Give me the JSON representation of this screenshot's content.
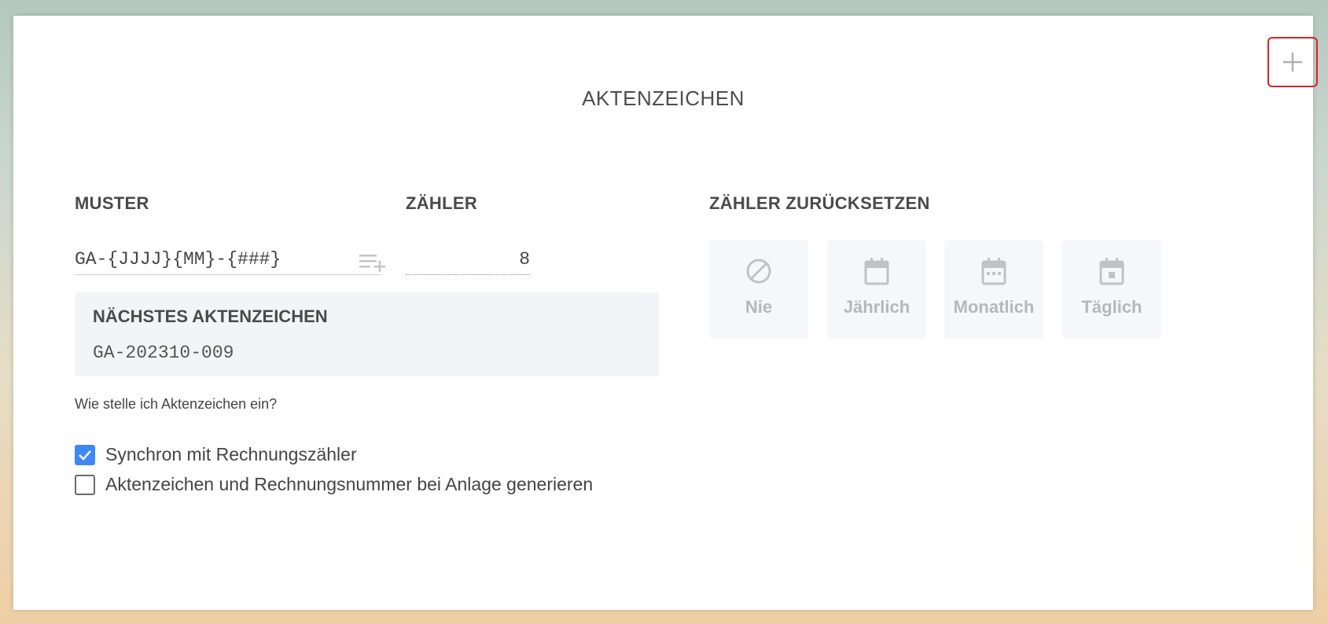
{
  "header": {
    "title": "AKTENZEICHEN",
    "add_button": {
      "icon": "plus-icon"
    }
  },
  "pattern": {
    "label": "MUSTER",
    "value": "GA-{JJJJ}{MM}-{###}",
    "insert_icon": "playlist-add-icon"
  },
  "counter": {
    "label": "ZÄHLER",
    "value": "8"
  },
  "next": {
    "label": "NÄCHSTES AKTENZEICHEN",
    "value": "GA-202310-009"
  },
  "help": {
    "link_text": "Wie stelle ich Aktenzeichen ein?"
  },
  "options": [
    {
      "label": "Synchron mit Rechnungszähler",
      "checked": true
    },
    {
      "label": "Aktenzeichen und Rechnungsnummer bei Anlage generieren",
      "checked": false
    }
  ],
  "reset": {
    "label": "ZÄHLER ZURÜCKSETZEN",
    "options": [
      {
        "label": "Nie",
        "icon": "block-icon"
      },
      {
        "label": "Jährlich",
        "icon": "calendar-year-icon"
      },
      {
        "label": "Monatlich",
        "icon": "calendar-month-icon"
      },
      {
        "label": "Täglich",
        "icon": "calendar-day-icon"
      }
    ]
  },
  "colors": {
    "accent": "#3f87f5",
    "highlight_border": "#e0202a",
    "disabled_text": "#b7b7b7",
    "panel_bg": "#f3f4f7"
  }
}
